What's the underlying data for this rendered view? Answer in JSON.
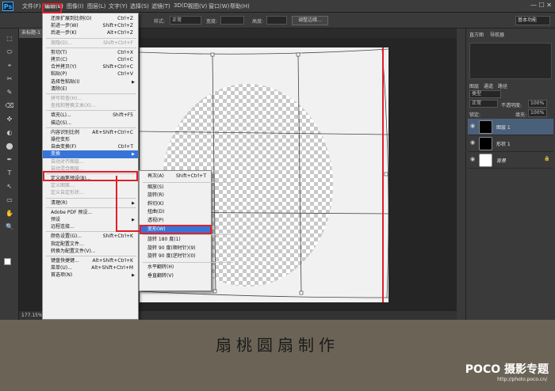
{
  "app": {
    "logo": "Ps",
    "menus": [
      "文件(F)",
      "编辑(E)",
      "图像(I)",
      "图层(L)",
      "文字(Y)",
      "选择(S)",
      "滤镜(T)",
      "3D(D)",
      "视图(V)",
      "窗口(W)",
      "帮助(H)"
    ],
    "window_controls": "— ☐ ✕"
  },
  "options": {
    "style_label": "样式:",
    "style_value": "正常",
    "width_label": "宽度:",
    "height_label": "高度:",
    "adjust_edge": "调整边缘...",
    "workspace": "基本功能"
  },
  "doc": {
    "tab": "未标题-1",
    "zoom": "177.15%"
  },
  "edit_menu": [
    {
      "label": "还原扩展到比例(O)",
      "sc": "Ctrl+Z"
    },
    {
      "label": "前进一步(W)",
      "sc": "Shift+Ctrl+Z"
    },
    {
      "label": "后退一步(K)",
      "sc": "Alt+Ctrl+Z"
    },
    {
      "sep": true
    },
    {
      "label": "渐隐(D)...",
      "sc": "Shift+Ctrl+F",
      "dis": true
    },
    {
      "sep": true
    },
    {
      "label": "剪切(T)",
      "sc": "Ctrl+X"
    },
    {
      "label": "拷贝(C)",
      "sc": "Ctrl+C"
    },
    {
      "label": "合并拷贝(Y)",
      "sc": "Shift+Ctrl+C"
    },
    {
      "label": "粘贴(P)",
      "sc": "Ctrl+V"
    },
    {
      "label": "选择性粘贴(I)",
      "sub": true
    },
    {
      "label": "清除(E)"
    },
    {
      "sep": true
    },
    {
      "label": "拼写检查(H)...",
      "dis": true
    },
    {
      "label": "查找和替换文本(X)...",
      "dis": true
    },
    {
      "sep": true
    },
    {
      "label": "填充(L)...",
      "sc": "Shift+F5"
    },
    {
      "label": "描边(S)..."
    },
    {
      "sep": true
    },
    {
      "label": "内容识别比例",
      "sc": "Alt+Shift+Ctrl+C"
    },
    {
      "label": "操控变形"
    },
    {
      "label": "自由变换(F)",
      "sc": "Ctrl+T"
    },
    {
      "label": "变换",
      "sub": true,
      "hl": true
    },
    {
      "label": "自动对齐图层...",
      "dis": true
    },
    {
      "label": "自动混合图层...",
      "dis": true
    },
    {
      "sep": true
    },
    {
      "label": "定义画笔预设(B)..."
    },
    {
      "label": "定义图案...",
      "dis": true
    },
    {
      "label": "定义自定形状...",
      "dis": true
    },
    {
      "sep": true
    },
    {
      "label": "清理(R)",
      "sub": true
    },
    {
      "sep": true
    },
    {
      "label": "Adobe PDF 预设..."
    },
    {
      "label": "预设",
      "sub": true
    },
    {
      "label": "远程连接..."
    },
    {
      "sep": true
    },
    {
      "label": "颜色设置(G)...",
      "sc": "Shift+Ctrl+K"
    },
    {
      "label": "指定配置文件..."
    },
    {
      "label": "转换为配置文件(V)..."
    },
    {
      "sep": true
    },
    {
      "label": "键盘快捷键...",
      "sc": "Alt+Shift+Ctrl+K"
    },
    {
      "label": "菜单(U)...",
      "sc": "Alt+Shift+Ctrl+M"
    },
    {
      "label": "首选项(N)",
      "sub": true
    }
  ],
  "transform_menu": [
    {
      "label": "再次(A)",
      "sc": "Shift+Ctrl+T"
    },
    {
      "sep": true
    },
    {
      "label": "缩放(S)"
    },
    {
      "label": "旋转(R)"
    },
    {
      "label": "斜切(K)"
    },
    {
      "label": "扭曲(D)"
    },
    {
      "label": "透视(P)"
    },
    {
      "label": "变形(W)",
      "hl": true
    },
    {
      "sep": true
    },
    {
      "label": "旋转 180 度(1)"
    },
    {
      "label": "旋转 90 度(顺时针)(9)"
    },
    {
      "label": "旋转 90 度(逆时针)(0)"
    },
    {
      "sep": true
    },
    {
      "label": "水平翻转(H)"
    },
    {
      "label": "垂直翻转(V)"
    }
  ],
  "panels": {
    "tabs": [
      "直方图",
      "导航器"
    ],
    "layer_tabs": [
      "图层",
      "通道",
      "路径"
    ],
    "kind": "类型",
    "blend": "正常",
    "opacity_label": "不透明度:",
    "opacity": "100%",
    "lock_label": "锁定:",
    "fill_label": "填充:",
    "fill": "100%",
    "layers": [
      "图层 1",
      "形状 1",
      "背景"
    ]
  },
  "caption": "扇桃圆扇制作",
  "brand": "POCO 摄影专题",
  "brand_sub": "http://photo.poco.cn/",
  "colors": {
    "highlight": "#3874d8",
    "annotation": "#e0202a"
  }
}
